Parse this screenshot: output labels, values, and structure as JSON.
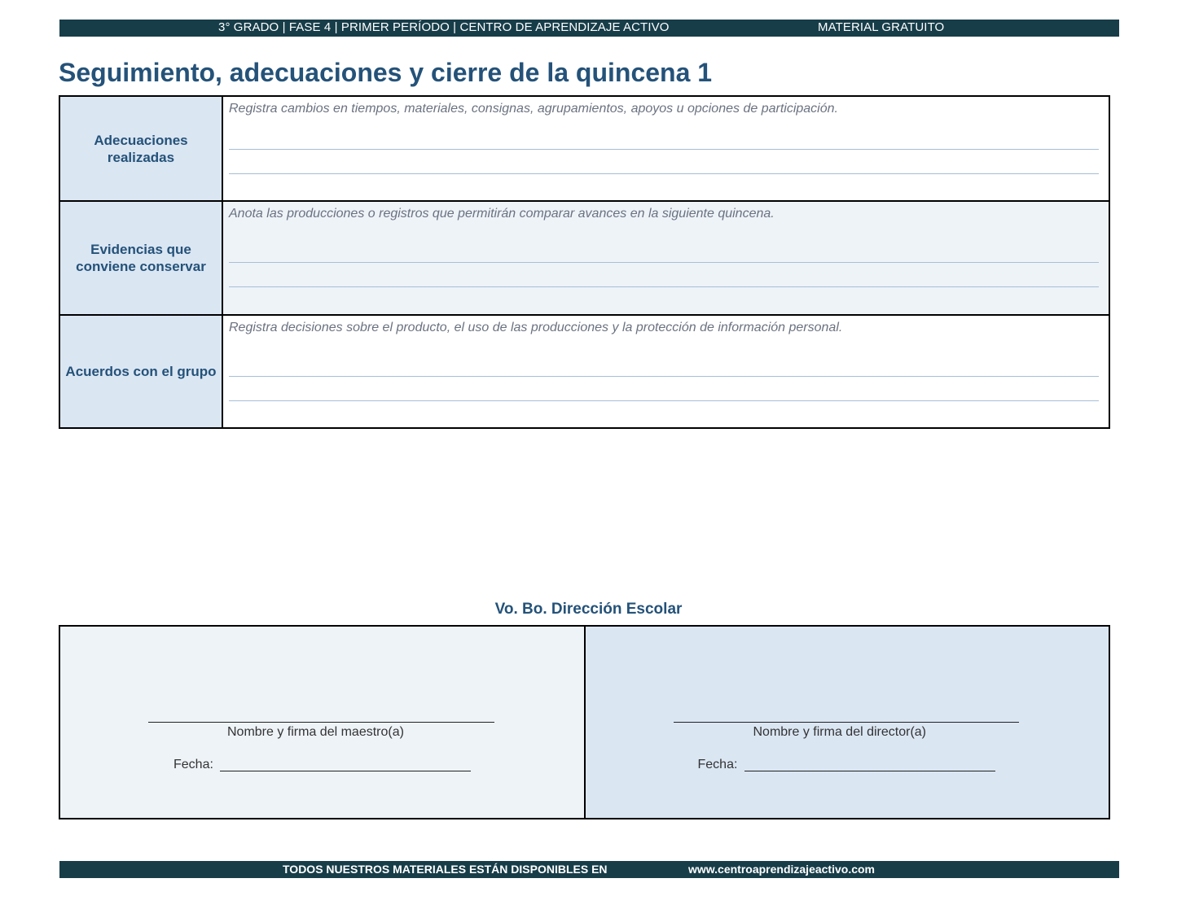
{
  "header": {
    "info": "3° GRADO  |  FASE 4  |  PRIMER PERÍODO  |  CENTRO DE APRENDIZAJE ACTIVO",
    "free": "MATERIAL GRATUITO"
  },
  "title": "Seguimiento, adecuaciones y cierre de la quincena 1",
  "rows": [
    {
      "label": "Adecuaciones realizadas",
      "hint": "Registra cambios en tiempos, materiales, consignas, agrupamientos, apoyos u opciones de participación."
    },
    {
      "label": "Evidencias que conviene conservar",
      "hint": "Anota las producciones o registros que permitirán comparar avances en la siguiente quincena."
    },
    {
      "label": "Acuerdos con el grupo",
      "hint": "Registra decisiones sobre el producto, el uso de las producciones y la protección de información personal."
    }
  ],
  "approval": {
    "heading": "Vo. Bo. Dirección Escolar",
    "teacher_label": "Nombre y firma del maestro(a)",
    "director_label": "Nombre y firma del director(a)",
    "date_label": "Fecha:"
  },
  "footer": {
    "text": "TODOS NUESTROS MATERIALES ESTÁN DISPONIBLES EN",
    "url": "www.centroaprendizajeactivo.com"
  },
  "colors": {
    "bar": "#173d49",
    "title": "#245279",
    "label_fill": "#dbe6f3",
    "light_fill": "#eef3f8"
  }
}
